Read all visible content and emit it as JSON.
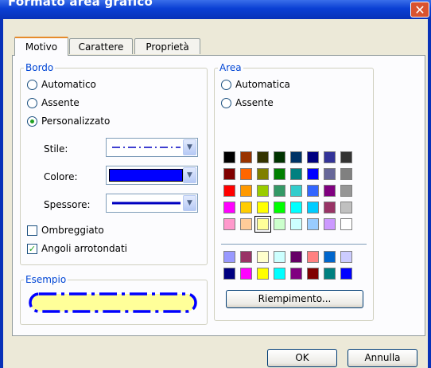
{
  "window": {
    "title": "Formato area grafico",
    "close_glyph": "✕"
  },
  "tabs": [
    {
      "label": "Motivo",
      "active": true
    },
    {
      "label": "Carattere",
      "active": false
    },
    {
      "label": "Proprietà",
      "active": false
    }
  ],
  "bordo": {
    "label": "Bordo",
    "options": [
      {
        "label": "Automatico",
        "selected": false
      },
      {
        "label": "Assente",
        "selected": false
      },
      {
        "label": "Personalizzato",
        "selected": true
      }
    ],
    "stile_label": "Stile:",
    "colore_label": "Colore:",
    "colore_value": "#0000ff",
    "spessore_label": "Spessore:",
    "ombreggiato_label": "Ombreggiato",
    "ombreggiato_checked": false,
    "angoli_label": "Angoli arrotondati",
    "angoli_checked": true,
    "check_glyph": "✓"
  },
  "esempio": {
    "label": "Esempio",
    "fill": "#ffff99",
    "border": "#0000ff"
  },
  "area": {
    "label": "Area",
    "options": [
      {
        "label": "Automatica",
        "selected": false
      },
      {
        "label": "Assente",
        "selected": false
      }
    ],
    "palette_main": [
      [
        "#000000",
        "#993300",
        "#333300",
        "#003300",
        "#003366",
        "#000080",
        "#333399",
        "#333333"
      ],
      [
        "#800000",
        "#ff6600",
        "#808000",
        "#008000",
        "#008080",
        "#0000ff",
        "#666699",
        "#808080"
      ],
      [
        "#ff0000",
        "#ff9900",
        "#99cc00",
        "#339966",
        "#33cccc",
        "#3366ff",
        "#800080",
        "#969696"
      ],
      [
        "#ff00ff",
        "#ffcc00",
        "#ffff00",
        "#00ff00",
        "#00ffff",
        "#00ccff",
        "#993366",
        "#c0c0c0"
      ],
      [
        "#ff99cc",
        "#ffcc99",
        "#ffff99",
        "#ccffcc",
        "#ccffff",
        "#99ccff",
        "#cc99ff",
        "#ffffff"
      ]
    ],
    "palette_extra": [
      [
        "#9999ff",
        "#993366",
        "#ffffcc",
        "#ccffff",
        "#660066",
        "#ff8080",
        "#0066cc",
        "#ccccff"
      ],
      [
        "#000080",
        "#ff00ff",
        "#ffff00",
        "#00ffff",
        "#800080",
        "#800000",
        "#008080",
        "#0000ff"
      ]
    ],
    "selected_swatch": "#ffff99",
    "fill_button": "Riempimento..."
  },
  "footer": {
    "ok": "OK",
    "cancel": "Annulla"
  }
}
